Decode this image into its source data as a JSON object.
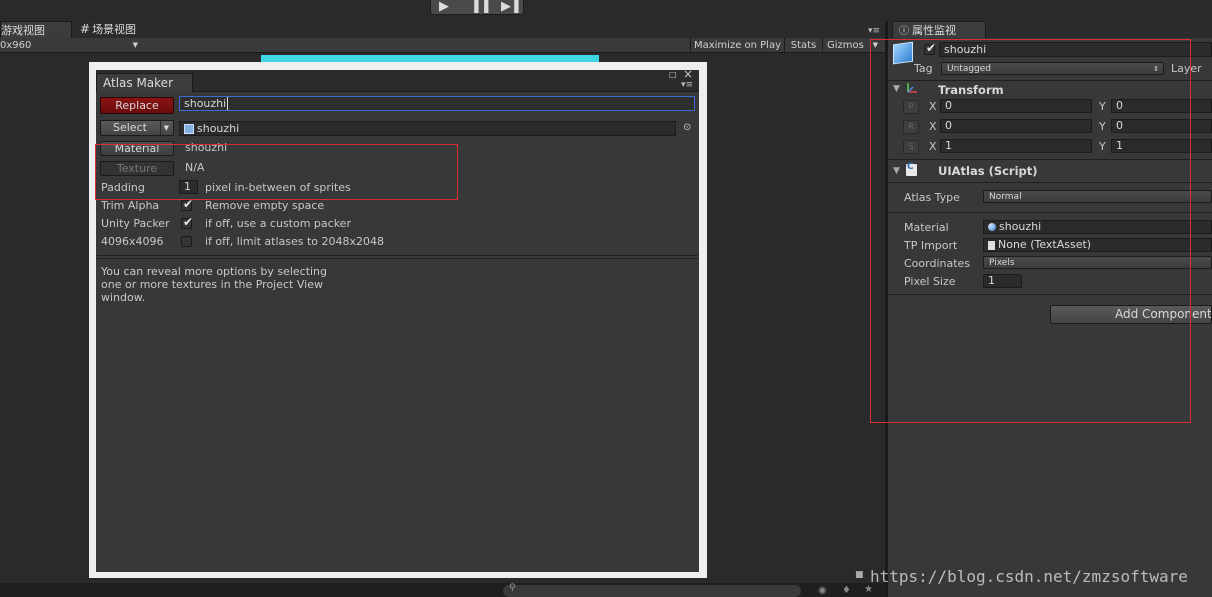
{
  "toolbar": {
    "play_icon": "play-icon",
    "pause_icon": "pause-icon",
    "step_icon": "step-icon",
    "game_tab": "游戏视图",
    "scene_tab": "场景视图",
    "resolution": "0x960",
    "maximize_on_play": "Maximize on Play",
    "stats": "Stats",
    "gizmos": "Gizmos"
  },
  "atlas_maker": {
    "tab": "Atlas Maker",
    "replace_label": "Replace",
    "name_value": "shouzhi",
    "select_label": "Select",
    "atlas_ref": "shouzhi",
    "material_label": "Material",
    "material_value": "shouzhi",
    "texture_label": "Texture",
    "texture_value": "N/A",
    "padding_label": "Padding",
    "padding_value": "1",
    "padding_desc": "pixel in-between of sprites",
    "trim_label": "Trim Alpha",
    "trim_desc": "Remove empty space",
    "packer_label": "Unity Packer",
    "packer_desc": "if off, use a custom packer",
    "size_label": "4096x4096",
    "size_desc": "if off, limit atlases to 2048x2048",
    "hint_line1": "You can reveal more options by selecting",
    "hint_line2": "one or more textures in the Project View",
    "hint_line3": "window.",
    "trim_checked": true,
    "packer_checked": true,
    "size_checked": false
  },
  "inspector": {
    "tab": "属性监视",
    "object_name": "shouzhi",
    "tag_label": "Tag",
    "tag_value": "Untagged",
    "layer_label": "Layer",
    "transform_title": "Transform",
    "p_label": "P",
    "r_label": "R",
    "s_label": "S",
    "x_label": "X",
    "y_label": "Y",
    "pos_x": "0",
    "pos_y": "0",
    "rot_x": "0",
    "rot_y": "0",
    "scale_x": "1",
    "scale_y": "1",
    "script_title": "UIAtlas (Script)",
    "atlas_type_label": "Atlas Type",
    "atlas_type_value": "Normal",
    "material_label": "Material",
    "material_value": "shouzhi",
    "tp_import_label": "TP Import",
    "tp_import_value": "None (TextAsset)",
    "coordinates_label": "Coordinates",
    "coordinates_value": "Pixels",
    "pixel_size_label": "Pixel Size",
    "pixel_size_value": "1",
    "add_component": "Add Component"
  },
  "watermark": "https://blog.csdn.net/zmzsoftware",
  "colors": {
    "accent_cyan": "#3fd6e6",
    "annotation_red": "#d63030",
    "replace_red": "#7a0f0f"
  }
}
